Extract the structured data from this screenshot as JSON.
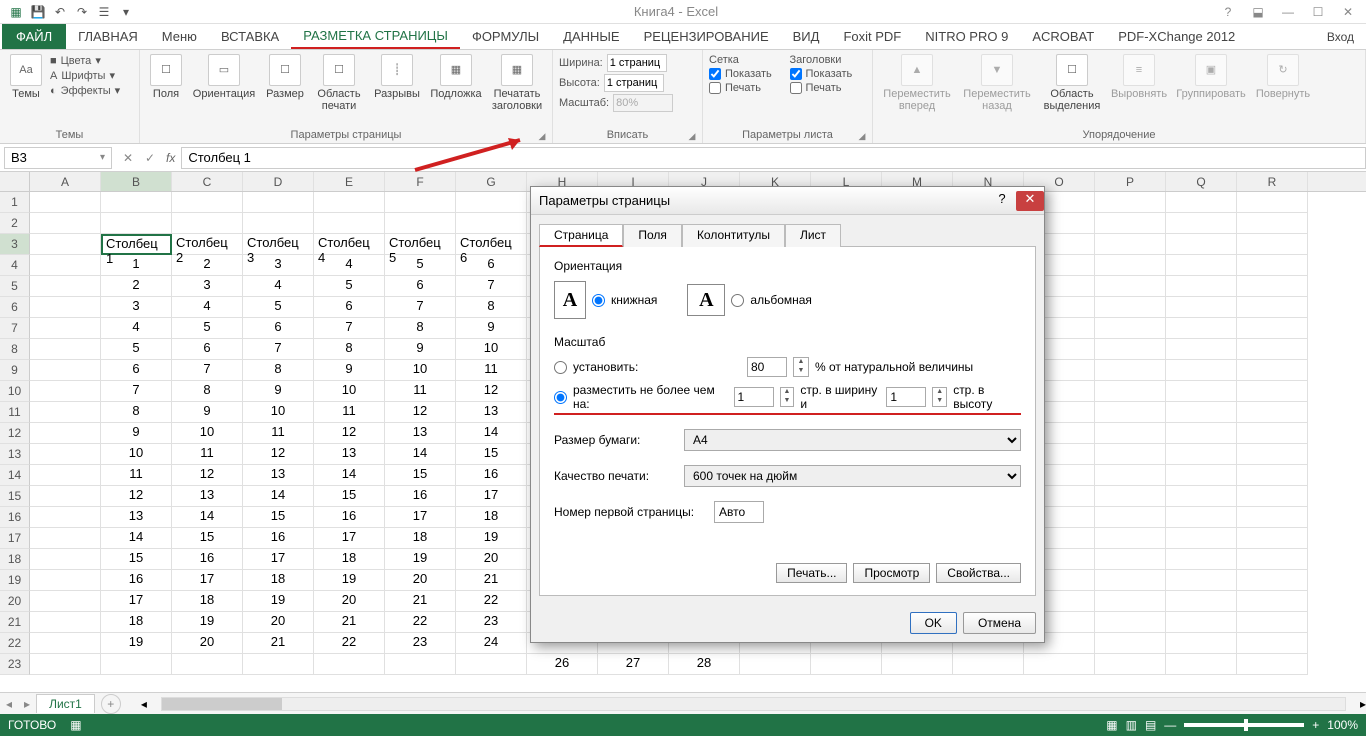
{
  "app_title": "Книга4 - Excel",
  "tabs": {
    "file": "ФАЙЛ",
    "list": [
      "ГЛАВНАЯ",
      "Меню",
      "ВСТАВКА",
      "РАЗМЕТКА СТРАНИЦЫ",
      "ФОРМУЛЫ",
      "ДАННЫЕ",
      "РЕЦЕНЗИРОВАНИЕ",
      "ВИД",
      "Foxit PDF",
      "NITRO PRO 9",
      "ACROBAT",
      "PDF-XChange 2012"
    ],
    "active_index": 3,
    "signin": "Вход"
  },
  "ribbon": {
    "themes_group": "Темы",
    "themes_btn": "Темы",
    "colors": "Цвета",
    "fonts": "Шрифты",
    "effects": "Эффекты",
    "page_setup_group": "Параметры страницы",
    "margins": "Поля",
    "orientation": "Ориентация",
    "size": "Размер",
    "print_area": "Область печати",
    "breaks": "Разрывы",
    "background": "Подложка",
    "print_titles": "Печатать заголовки",
    "fit_group": "Вписать",
    "width": "Ширина:",
    "height": "Высота:",
    "scale": "Масштаб:",
    "width_val": "1 страниц",
    "height_val": "1 страниц",
    "scale_val": "80%",
    "sheet_opts_group": "Параметры листа",
    "grid": "Сетка",
    "headings": "Заголовки",
    "show": "Показать",
    "print": "Печать",
    "arrange_group": "Упорядочение",
    "forward": "Переместить вперед",
    "backward": "Переместить назад",
    "selection": "Область выделения",
    "align": "Выровнять",
    "group": "Группировать",
    "rotate": "Повернуть"
  },
  "namebox": "B3",
  "formula": "Столбец 1",
  "columns": [
    "A",
    "B",
    "C",
    "D",
    "E",
    "F",
    "G",
    "H",
    "I",
    "J",
    "K",
    "L",
    "M",
    "N",
    "O",
    "P",
    "Q",
    "R"
  ],
  "sheet": {
    "headers_row": 3,
    "headers": [
      "Столбец 1",
      "Столбец 2",
      "Столбец 3",
      "Столбец 4",
      "Столбец 5",
      "Столбец 6"
    ],
    "data": [
      [
        1,
        2,
        3,
        4,
        5,
        6
      ],
      [
        2,
        3,
        4,
        5,
        6,
        7
      ],
      [
        3,
        4,
        5,
        6,
        7,
        8
      ],
      [
        4,
        5,
        6,
        7,
        8,
        9
      ],
      [
        5,
        6,
        7,
        8,
        9,
        10
      ],
      [
        6,
        7,
        8,
        9,
        10,
        11
      ],
      [
        7,
        8,
        9,
        10,
        11,
        12
      ],
      [
        8,
        9,
        10,
        11,
        12,
        13
      ],
      [
        9,
        10,
        11,
        12,
        13,
        14
      ],
      [
        10,
        11,
        12,
        13,
        14,
        15
      ],
      [
        11,
        12,
        13,
        14,
        15,
        16
      ],
      [
        12,
        13,
        14,
        15,
        16,
        17
      ],
      [
        13,
        14,
        15,
        16,
        17,
        18
      ],
      [
        14,
        15,
        16,
        17,
        18,
        19
      ],
      [
        15,
        16,
        17,
        18,
        19,
        20
      ],
      [
        16,
        17,
        18,
        19,
        20,
        21
      ],
      [
        17,
        18,
        19,
        20,
        21,
        22
      ],
      [
        18,
        19,
        20,
        21,
        22,
        23
      ],
      [
        19,
        20,
        21,
        22,
        23,
        24
      ]
    ],
    "extra_row": [
      "",
      "",
      "",
      "",
      "",
      "",
      "",
      26,
      27,
      28
    ]
  },
  "sheet_tab": "Лист1",
  "status": "ГОТОВО",
  "zoom": "100%",
  "dialog": {
    "title": "Параметры страницы",
    "tabs": [
      "Страница",
      "Поля",
      "Колонтитулы",
      "Лист"
    ],
    "orientation_label": "Ориентация",
    "portrait": "книжная",
    "landscape": "альбомная",
    "scale_label": "Масштаб",
    "set_scale": "установить:",
    "set_scale_val": "80",
    "set_scale_suffix": "% от натуральной величины",
    "fit_to": "разместить не более чем на:",
    "fit_w": "1",
    "fit_w_suffix": "стр. в ширину и",
    "fit_h": "1",
    "fit_h_suffix": "стр. в высоту",
    "paper_size": "Размер бумаги:",
    "paper_val": "A4",
    "print_quality": "Качество печати:",
    "quality_val": "600 точек на дюйм",
    "first_page": "Номер первой страницы:",
    "first_page_val": "Авто",
    "btn_print": "Печать...",
    "btn_preview": "Просмотр",
    "btn_props": "Свойства...",
    "btn_ok": "OK",
    "btn_cancel": "Отмена"
  }
}
